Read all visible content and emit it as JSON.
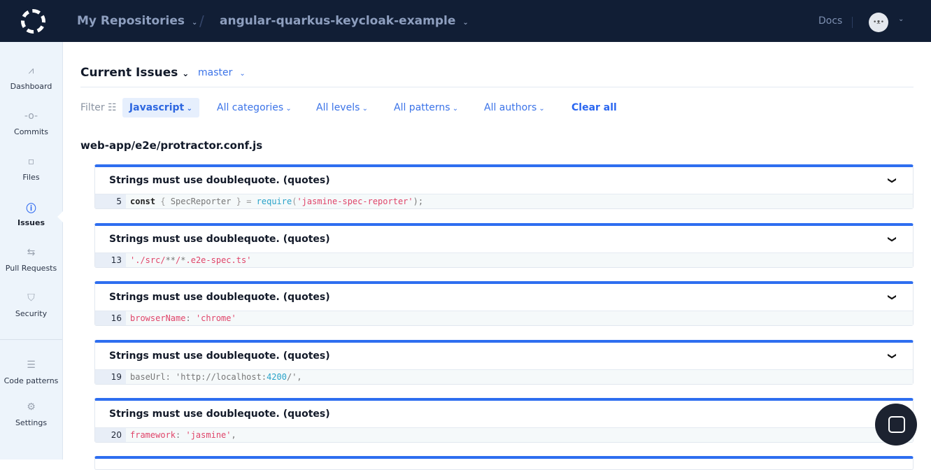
{
  "header": {
    "repos": "My Repositories",
    "separator": "/",
    "repo": "angular-quarkus-keycloak-example",
    "docs": "Docs",
    "avatar": "•ᴥ•"
  },
  "sidebar": {
    "items": [
      {
        "label": "Dashboard",
        "icon": "dashboard-icon",
        "glyph": "⩘"
      },
      {
        "label": "Commits",
        "icon": "commit-icon",
        "glyph": "-o-"
      },
      {
        "label": "Files",
        "icon": "file-icon",
        "glyph": "▫"
      },
      {
        "label": "Issues",
        "icon": "issues-icon",
        "glyph": "ⓘ"
      },
      {
        "label": "Pull Requests",
        "icon": "pull-request-icon",
        "glyph": "⇆"
      },
      {
        "label": "Security",
        "icon": "shield-icon",
        "glyph": "⛉"
      },
      {
        "label": "Code patterns",
        "icon": "list-icon",
        "glyph": "☰"
      },
      {
        "label": "Settings",
        "icon": "gear-icon",
        "glyph": "⚙"
      }
    ]
  },
  "page": {
    "title": "Current Issues",
    "branch": "master",
    "file_path": "web-app/e2e/protractor.conf.js"
  },
  "filters": {
    "label": "Filter",
    "language": "Javascript",
    "categories": "All categories",
    "levels": "All levels",
    "patterns": "All patterns",
    "authors": "All authors",
    "clear": "Clear all"
  },
  "issues": [
    {
      "title": "Strings must use doublequote. (quotes)",
      "line": "5",
      "tokens": [
        [
          "kw",
          "const"
        ],
        [
          "p",
          " { "
        ],
        [
          "t",
          "SpecReporter"
        ],
        [
          "p",
          " } = "
        ],
        [
          "fn",
          "require"
        ],
        [
          "p",
          "("
        ],
        [
          "s",
          "'jasmine-spec-reporter'"
        ],
        [
          "t",
          ");"
        ]
      ]
    },
    {
      "title": "Strings must use doublequote. (quotes)",
      "line": "13",
      "tokens": [
        [
          "s",
          "'./src/"
        ],
        [
          "t",
          "**"
        ],
        [
          "s",
          "/"
        ],
        [
          "t",
          "*"
        ],
        [
          "s",
          ".e2e-spec.ts'"
        ]
      ]
    },
    {
      "title": "Strings must use doublequote. (quotes)",
      "line": "16",
      "tokens": [
        [
          "s",
          "browserName"
        ],
        [
          "t",
          ": "
        ],
        [
          "s",
          "'chrome'"
        ]
      ]
    },
    {
      "title": "Strings must use doublequote. (quotes)",
      "line": "19",
      "tokens": [
        [
          "t",
          "baseUrl: 'http://localhost:"
        ],
        [
          "n",
          "4200"
        ],
        [
          "t",
          "/',"
        ]
      ]
    },
    {
      "title": "Strings must use doublequote. (quotes)",
      "line": "20",
      "tokens": [
        [
          "s",
          "framework"
        ],
        [
          "t",
          ": "
        ],
        [
          "s",
          "'jasmine'"
        ],
        [
          "t",
          ","
        ]
      ]
    }
  ],
  "colors": {
    "accent": "#2e6ef0",
    "topbar": "#111e35",
    "sidebar": "#edf4fb"
  }
}
